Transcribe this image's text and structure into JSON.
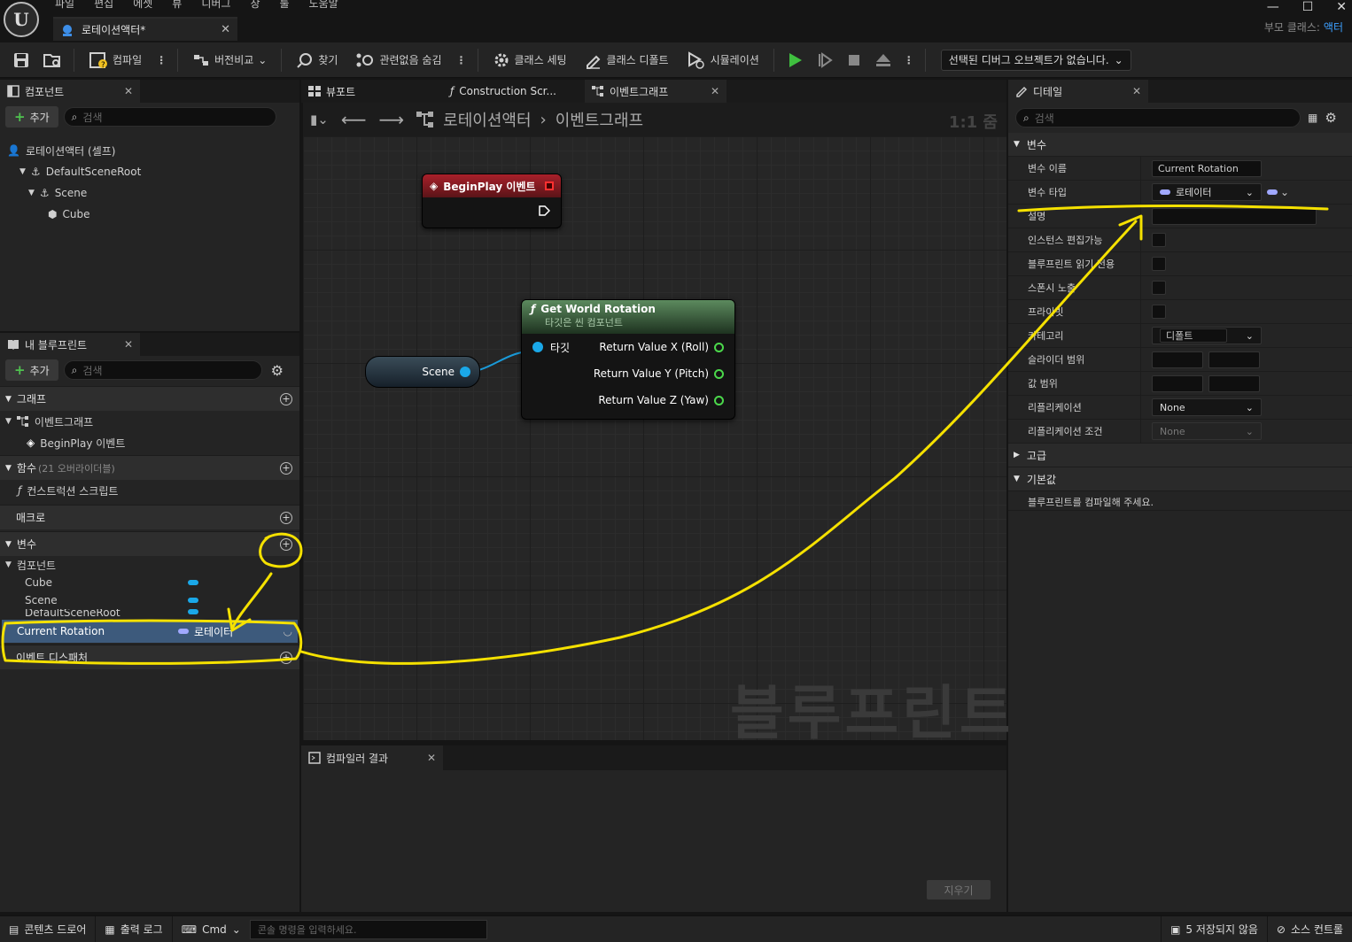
{
  "title_bar": {
    "menu": [
      "파일",
      "편집",
      "에셋",
      "뷰",
      "디버그",
      "창",
      "툴",
      "도움말"
    ],
    "doc_tab": "로테이션액터*",
    "parent_label": "부모 클래스:",
    "parent_value": "액터"
  },
  "toolbar": {
    "compile": "컴파일",
    "diff": "버전비교",
    "find": "찾기",
    "hide_unrelated": "관련없음 숨김",
    "class_settings": "클래스 세팅",
    "class_defaults": "클래스 디폴트",
    "simulation": "시뮬레이션",
    "debug_object": "선택된 디버그 오브젝트가 없습니다."
  },
  "components": {
    "tab": "컴포넌트",
    "add": "추가",
    "search_placeholder": "검색",
    "tree": [
      "로테이션액터 (셀프)",
      "DefaultSceneRoot",
      "Scene",
      "Cube"
    ]
  },
  "my_blueprint": {
    "tab": "내 블루프린트",
    "add": "추가",
    "search_placeholder": "검색",
    "graphs_header": "그래프",
    "event_graph": "이벤트그래프",
    "begin_play": "BeginPlay 이벤트",
    "functions_header": "함수",
    "functions_overridable": "(21 오버라이더블)",
    "construction_script": "컨스트럭션 스크립트",
    "macros_header": "매크로",
    "variables_header": "변수",
    "components_group": "컴포넌트",
    "variables": [
      {
        "name": "Cube",
        "type": "",
        "color": "#1aa8e8"
      },
      {
        "name": "Scene",
        "type": "",
        "color": "#1aa8e8"
      },
      {
        "name": "DefaultSceneRoot",
        "type": "",
        "color": "#1aa8e8"
      }
    ],
    "selected_variable": {
      "name": "Current Rotation",
      "type": "로테이터",
      "color": "#a0a8ff"
    },
    "dispatchers_header": "이벤트 디스패처"
  },
  "graph": {
    "tabs": [
      "뷰포트",
      "Construction Scr...",
      "이벤트그래프"
    ],
    "breadcrumb_root": "로테이션액터",
    "breadcrumb_current": "이벤트그래프",
    "zoom": "1:1 줌",
    "begin_play_node": "BeginPlay 이벤트",
    "scene_node": "Scene",
    "get_rotation_title": "Get World Rotation",
    "get_rotation_subtitle": "타깃은 씬 컴포넌트",
    "target_pin": "타깃",
    "outputs": [
      "Return Value X (Roll)",
      "Return Value Y (Pitch)",
      "Return Value Z (Yaw)"
    ],
    "watermark": "블루프린트"
  },
  "compiler": {
    "tab": "컴파일러 결과",
    "clear": "지우기"
  },
  "details": {
    "tab": "디테일",
    "search_placeholder": "검색",
    "variable_section": "변수",
    "labels": {
      "var_name": "변수 이름",
      "var_type": "변수 타입",
      "description": "설명",
      "instance_editable": "인스턴스 편집가능",
      "bp_readonly": "블루프린트 읽기 전용",
      "expose_spawn": "스폰시 노출",
      "private": "프라이빗",
      "category": "카테고리",
      "slider_range": "슬라이더 범위",
      "value_range": "값 범위",
      "replication": "리플리케이션",
      "replication_condition": "리플리케이션 조건"
    },
    "values": {
      "var_name": "Current Rotation",
      "var_type": "로테이터",
      "category": "디폴트",
      "replication": "None",
      "replication_condition": "None"
    },
    "advanced_section": "고급",
    "default_section": "기본값",
    "compile_notice": "블루프린트를 컴파일해 주세요."
  },
  "status_bar": {
    "content_drawer": "콘텐츠 드로어",
    "output_log": "출력 로그",
    "cmd": "Cmd",
    "console_placeholder": "콘솔 명령을 입력하세요.",
    "unsaved": "5 저장되지 않음",
    "source_control": "소스 컨트롤"
  }
}
